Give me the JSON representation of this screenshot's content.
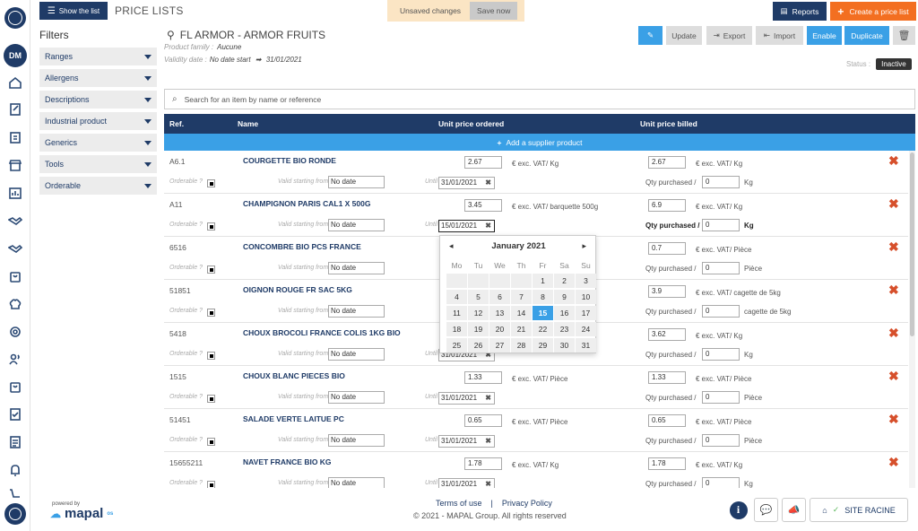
{
  "topbar": {
    "show_list": "Show the list",
    "title": "PRICE LISTS",
    "unsaved": "Unsaved changes",
    "save_now": "Save now",
    "reports": "Reports",
    "create": "Create a price list"
  },
  "rail": {
    "avatar": "DM"
  },
  "filters": {
    "title": "Filters",
    "groups": [
      "Ranges",
      "Allergens",
      "Descriptions",
      "Industrial product",
      "Generics",
      "Tools",
      "Orderable"
    ]
  },
  "info": {
    "supplier": "FL ARMOR - ARMOR FRUITS",
    "family_label": "Product family :",
    "family_value": "Aucune",
    "validity_label": "Validity date :",
    "validity_start": "No date start",
    "validity_end": "31/01/2021",
    "status_label": "Status :",
    "status_value": "Inactive"
  },
  "toolbar": {
    "update": "Update",
    "export": "Export",
    "import": "Import",
    "enable": "Enable",
    "duplicate": "Duplicate"
  },
  "search": {
    "placeholder": "Search for an item by name or reference"
  },
  "table": {
    "col_ref": "Ref.",
    "col_name": "Name",
    "col_upo": "Unit price ordered",
    "col_upb": "Unit price billed",
    "add": "Add a supplier product",
    "orderable_label": "Orderable ?",
    "valid_label": "Valid starting from",
    "until_label": "Until",
    "qty_label": "Qty purchased /",
    "rows": [
      {
        "ref": "A6.1",
        "name": "COURGETTE BIO RONDE",
        "vs": "No date",
        "until": "31/01/2021",
        "upo": "2.67",
        "upo_unit": "€ exc. VAT/ Kg",
        "upb": "2.67",
        "upb_unit": "€ exc. VAT/ Kg",
        "qty": "0",
        "qty_unit": "Kg"
      },
      {
        "ref": "A11",
        "name": "CHAMPIGNON PARIS CAL1 X 500G",
        "vs": "No date",
        "until": "15/01/2021",
        "upo": "3.45",
        "upo_unit": "€ exc. VAT/ barquette 500g",
        "upb": "6.9",
        "upb_unit": "€ exc. VAT/ Kg",
        "qty": "0",
        "qty_unit": "Kg"
      },
      {
        "ref": "6516",
        "name": "CONCOMBRE BIO PCS FRANCE",
        "vs": "No date",
        "until": "",
        "upo": "",
        "upo_unit": "",
        "upb": "0.7",
        "upb_unit": "€ exc. VAT/ Pièce",
        "qty": "0",
        "qty_unit": "Pièce"
      },
      {
        "ref": "51851",
        "name": "OIGNON ROUGE FR SAC 5KG",
        "vs": "No date",
        "until": "",
        "upo": "",
        "upo_unit": "",
        "upb": "3.9",
        "upb_unit": "€ exc. VAT/ cagette de 5kg",
        "qty": "0",
        "qty_unit": "cagette de 5kg"
      },
      {
        "ref": "5418",
        "name": "CHOUX BROCOLI FRANCE COLIS 1KG BIO",
        "vs": "No date",
        "until": "31/01/2021",
        "upo": "",
        "upo_unit": "",
        "upb": "3.62",
        "upb_unit": "€ exc. VAT/ Kg",
        "qty": "0",
        "qty_unit": "Kg"
      },
      {
        "ref": "1515",
        "name": "CHOUX BLANC PIECES BIO",
        "vs": "No date",
        "until": "31/01/2021",
        "upo": "1.33",
        "upo_unit": "€ exc. VAT/ Pièce",
        "upb": "1.33",
        "upb_unit": "€ exc. VAT/ Pièce",
        "qty": "0",
        "qty_unit": "Pièce"
      },
      {
        "ref": "51451",
        "name": "SALADE VERTE LAITUE PC",
        "vs": "No date",
        "until": "31/01/2021",
        "upo": "0.65",
        "upo_unit": "€ exc. VAT/ Pièce",
        "upb": "0.65",
        "upb_unit": "€ exc. VAT/ Pièce",
        "qty": "0",
        "qty_unit": "Pièce"
      },
      {
        "ref": "15655211",
        "name": "NAVET FRANCE BIO KG",
        "vs": "No date",
        "until": "31/01/2021",
        "upo": "1.78",
        "upo_unit": "€ exc. VAT/ Kg",
        "upb": "1.78",
        "upb_unit": "€ exc. VAT/ Kg",
        "qty": "0",
        "qty_unit": "Kg"
      }
    ]
  },
  "calendar": {
    "month": "January",
    "year": "2021",
    "dow": [
      "Mo",
      "Tu",
      "We",
      "Th",
      "Fr",
      "Sa",
      "Su"
    ],
    "weeks": [
      [
        "",
        "",
        "",
        "",
        "1",
        "2",
        "3"
      ],
      [
        "4",
        "5",
        "6",
        "7",
        "8",
        "9",
        "10"
      ],
      [
        "11",
        "12",
        "13",
        "14",
        "15",
        "16",
        "17"
      ],
      [
        "18",
        "19",
        "20",
        "21",
        "22",
        "23",
        "24"
      ],
      [
        "25",
        "26",
        "27",
        "28",
        "29",
        "30",
        "31"
      ]
    ],
    "selected": "15"
  },
  "footer": {
    "powered": "powered by",
    "brand": "mapal",
    "brand_sup": "os",
    "terms": "Terms of use",
    "sep": "|",
    "privacy": "Privacy Policy",
    "copyright": "© 2021 - MAPAL Group. All rights reserved",
    "site": "SITE RACINE"
  },
  "colors": {
    "navy": "#1f3b67",
    "accent": "#3aa0e6",
    "orange": "#f36f21",
    "delete": "#d64f2b"
  }
}
